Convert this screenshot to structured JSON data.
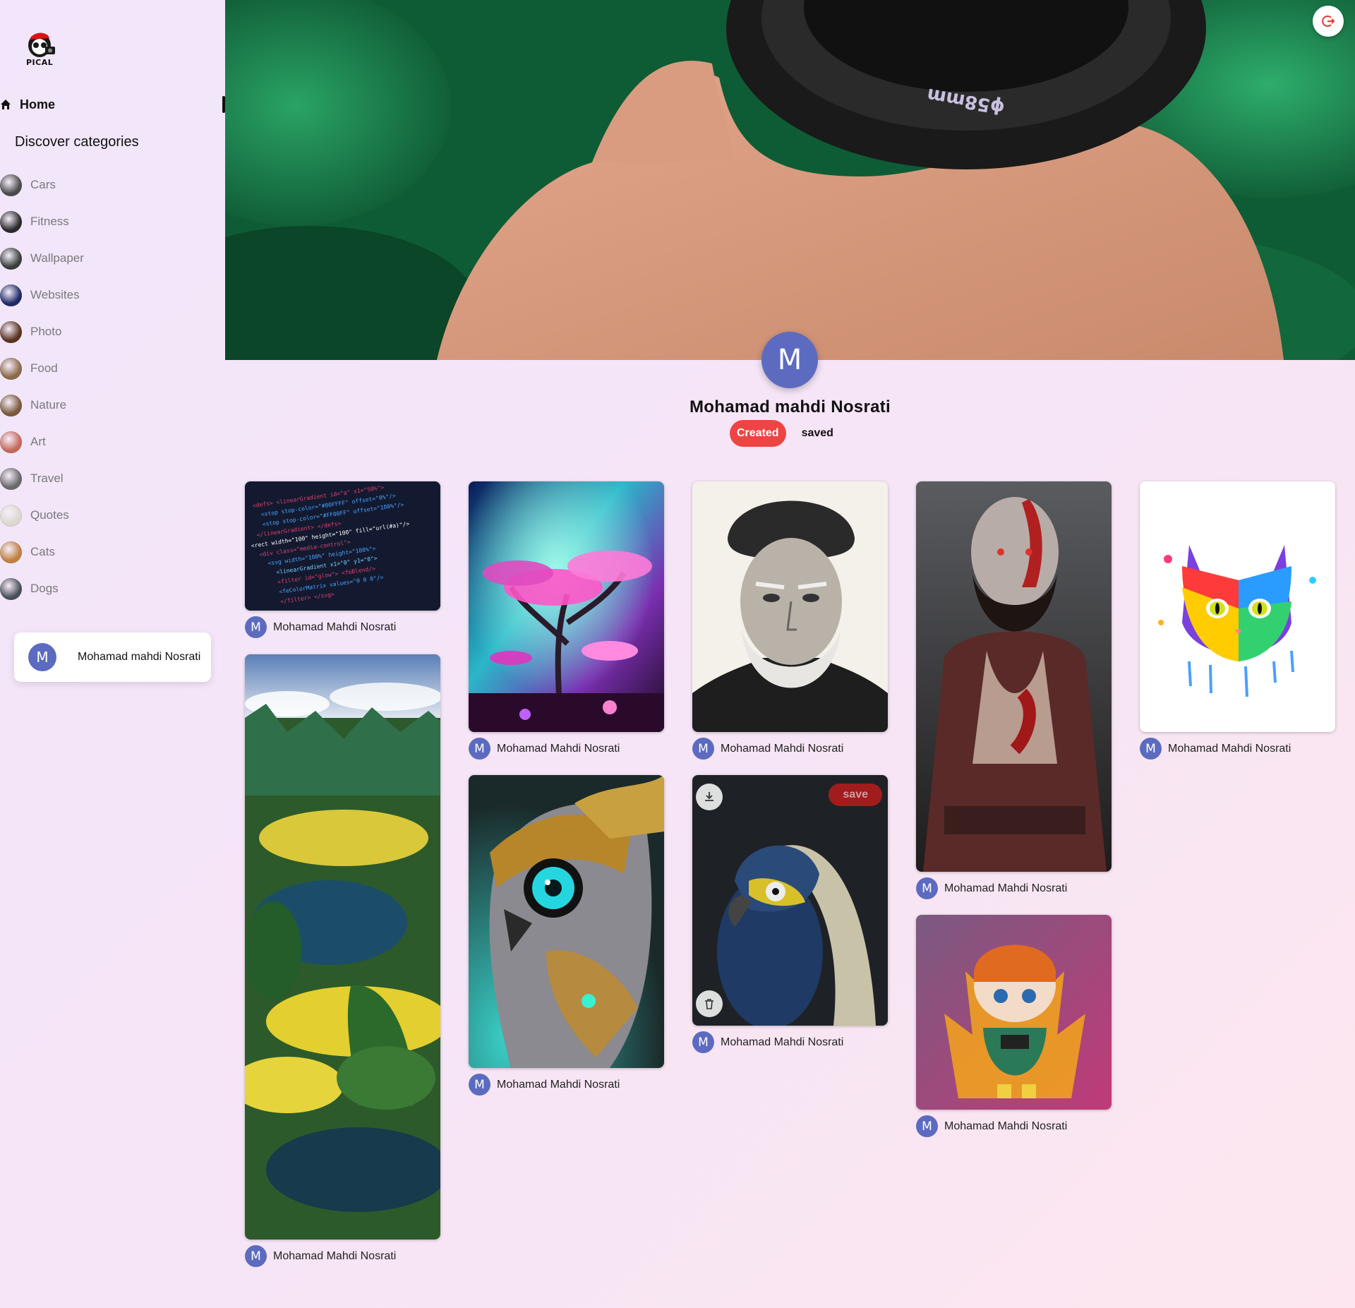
{
  "brand": {
    "logo_text": "PICAL"
  },
  "sidebar": {
    "home_label": "Home",
    "categories_title": "Discover categories",
    "categories": [
      {
        "label": "Cars",
        "color": "#4b4b4b"
      },
      {
        "label": "Fitness",
        "color": "#2a2a2a"
      },
      {
        "label": "Wallpaper",
        "color": "#3a3f3a"
      },
      {
        "label": "Websites",
        "color": "#1e2a66"
      },
      {
        "label": "Photo",
        "color": "#5a3322"
      },
      {
        "label": "Food",
        "color": "#8a6a4a"
      },
      {
        "label": "Nature",
        "color": "#7a5a3a"
      },
      {
        "label": "Art",
        "color": "#c46a5a"
      },
      {
        "label": "Travel",
        "color": "#6a6a6a"
      },
      {
        "label": "Quotes",
        "color": "#dcd8cf"
      },
      {
        "label": "Cats",
        "color": "#c08040"
      },
      {
        "label": "Dogs",
        "color": "#4a5058"
      }
    ],
    "user": {
      "initial": "M",
      "name": "Mohamad mahdi Nosrati"
    }
  },
  "profile": {
    "initial": "M",
    "name": "Mohamad mahdi Nosrati",
    "tabs": {
      "created": "Created",
      "saved": "saved"
    }
  },
  "pin_actions": {
    "save_label": "save"
  },
  "pins": [
    {
      "author": "Mohamad Mahdi Nosrati",
      "initial": "M",
      "subject": "code"
    },
    {
      "author": "Mohamad Mahdi Nosrati",
      "initial": "M",
      "subject": "landscape"
    },
    {
      "author": "Mohamad Mahdi Nosrati",
      "initial": "M",
      "subject": "mushroom-tree"
    },
    {
      "author": "Mohamad Mahdi Nosrati",
      "initial": "M",
      "subject": "owl"
    },
    {
      "author": "Mohamad Mahdi Nosrati",
      "initial": "M",
      "subject": "old-man"
    },
    {
      "author": "Mohamad Mahdi Nosrati",
      "initial": "M",
      "subject": "parrot"
    },
    {
      "author": "Mohamad Mahdi Nosrati",
      "initial": "M",
      "subject": "warrior"
    },
    {
      "author": "Mohamad Mahdi Nosrati",
      "initial": "M",
      "subject": "cat-hoodie"
    },
    {
      "author": "Mohamad Mahdi Nosrati",
      "initial": "M",
      "subject": "rainbow-cat"
    }
  ],
  "colors": {
    "accent": "#ef4444",
    "avatar": "#5c6bc0",
    "save": "#b91c1c"
  }
}
